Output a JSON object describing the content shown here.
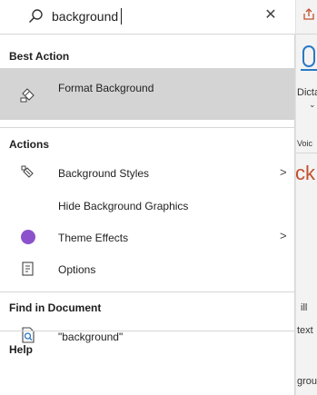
{
  "search": {
    "value": "background",
    "placeholder": ""
  },
  "best_action": {
    "title": "Best Action",
    "items": [
      {
        "label": "Format Background",
        "icon": "format-background-icon"
      }
    ]
  },
  "actions": {
    "title": "Actions",
    "items": [
      {
        "label": "Background Styles",
        "icon": "background-styles-icon",
        "submenu": true
      },
      {
        "label": "Hide Background Graphics",
        "icon": "",
        "submenu": false
      },
      {
        "label": "Theme Effects",
        "icon": "theme-effects-icon",
        "submenu": true
      },
      {
        "label": "Options",
        "icon": "options-icon",
        "submenu": false
      }
    ]
  },
  "find": {
    "title": "Find in Document",
    "items": [
      {
        "label": "\"background\"",
        "icon": "find-document-icon"
      }
    ]
  },
  "help": {
    "title": "Help"
  },
  "background_app": {
    "dictate": "Dicta",
    "voice": "Voic",
    "red_text": "ck",
    "ill": "ill",
    "texts": "text",
    "grou": "grou"
  },
  "colors": {
    "accent_purple": "#8c52cc",
    "highlight": "#d4d4d4",
    "brand_orange": "#c4502d",
    "brand_blue": "#2b78c5"
  }
}
